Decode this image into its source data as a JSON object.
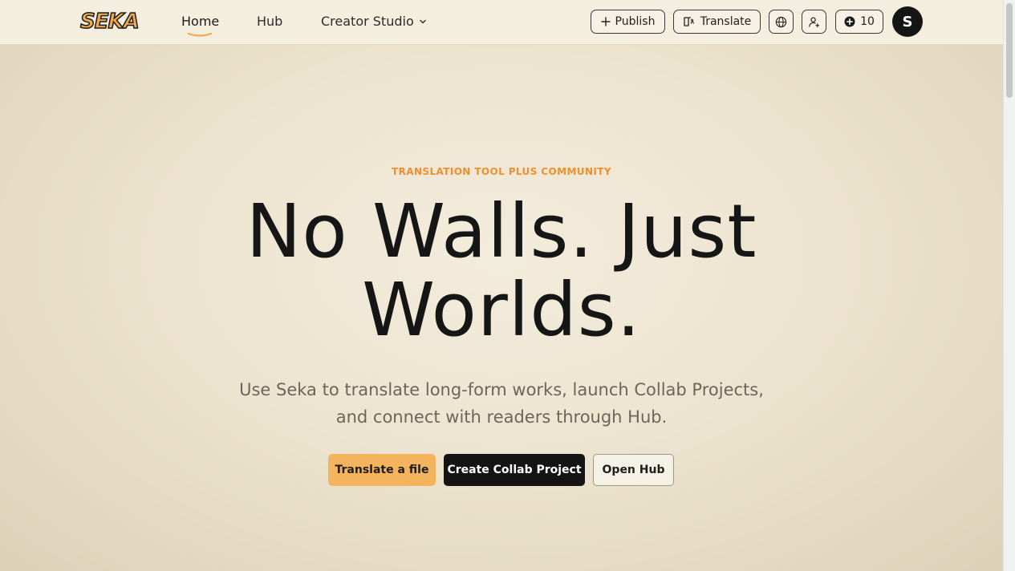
{
  "brand": {
    "logo_text": "SEKA"
  },
  "nav": {
    "home": "Home",
    "hub": "Hub",
    "creator_studio": "Creator Studio"
  },
  "toolbar": {
    "publish": "Publish",
    "translate": "Translate",
    "credits": "10",
    "avatar_initial": "S"
  },
  "hero": {
    "eyebrow": "TRANSLATION TOOL PLUS COMMUNITY",
    "headline_line1": "No Walls. Just",
    "headline_line2": "Worlds.",
    "subline": "Use Seka to translate long-form works, launch Collab Projects, and connect with readers through Hub.",
    "cta_translate": "Translate a file",
    "cta_collab": "Create Collab Project",
    "cta_hub": "Open Hub"
  },
  "colors": {
    "accent_orange": "#ef8f2e",
    "button_orange": "#f4b35f",
    "dark": "#141414"
  },
  "icons": [
    "plus-icon",
    "book-translate-icon",
    "globe-icon",
    "user-add-icon",
    "plus-circle-icon",
    "chevron-down-icon"
  ]
}
